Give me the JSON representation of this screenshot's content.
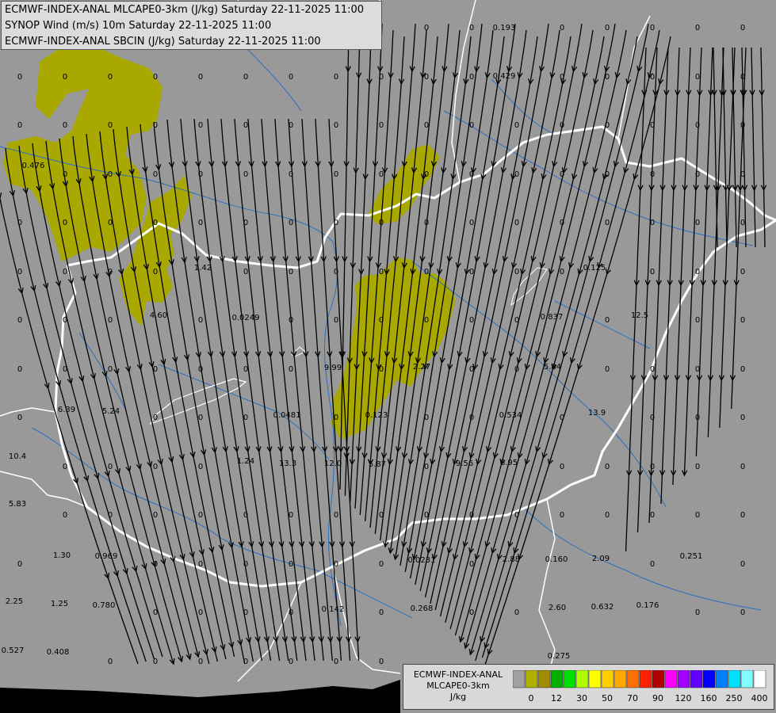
{
  "titles": [
    "ECMWF-INDEX-ANAL MLCAPE0-3km (J/kg) Saturday 22-11-2025 11:00",
    "SYNOP Wind (m/s) 10m Saturday 22-11-2025 11:00",
    "ECMWF-INDEX-ANAL SBCIN (J/kg) Saturday 22-11-2025 11:00"
  ],
  "legend": {
    "label_lines": [
      "ECMWF-INDEX-ANAL",
      "MLCAPE0-3km",
      "J/kg"
    ],
    "colors": [
      "#a0a0a0",
      "#b0b000",
      "#a08c00",
      "#00b000",
      "#00e000",
      "#b0ff00",
      "#ffff00",
      "#ffd000",
      "#ffa800",
      "#ff7000",
      "#ff2000",
      "#b00000",
      "#ff00ff",
      "#a000ff",
      "#6000ff",
      "#0000ff",
      "#0080ff",
      "#00e0ff",
      "#80ffff",
      "#ffffff"
    ],
    "ticks": [
      "0",
      "12",
      "30",
      "50",
      "70",
      "90",
      "120",
      "160",
      "250",
      "400"
    ]
  },
  "map_colors": {
    "background": "#999999",
    "cape_fill": "#a8a800",
    "border": "#ffffff",
    "river": "#2d6fc0",
    "streamline": "#000000"
  },
  "value_labels": [
    "0.193",
    "0.429",
    "0.476",
    "1.42",
    "4.60",
    "0.0249",
    "9.99",
    "2.27",
    "0.837",
    "0.125",
    "12.5",
    "5.84",
    "6.39",
    "5.24",
    "0.0481",
    "0.123",
    "0.534",
    "13.9",
    "10.4",
    "1.24",
    "13.3",
    "12.0",
    "5.87",
    "9.56",
    "6.95",
    "5.83",
    "1.30",
    "0.969",
    "0.0231",
    "2.88",
    "0.160",
    "2.09",
    "0.251",
    "2.25",
    "1.25",
    "0.780",
    "0.142",
    "0.268",
    "2.60",
    "0.632",
    "0.176",
    "0.527",
    "0.408",
    "0.275"
  ],
  "zero_label": "0"
}
